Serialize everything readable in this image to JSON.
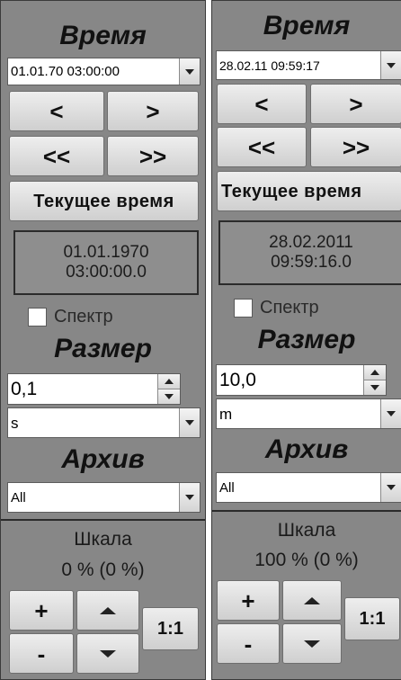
{
  "panel_a": {
    "time_title": "Время",
    "time_combo_value": "01.01.70 03:00:00",
    "prev_label": "<",
    "next_label": ">",
    "fast_prev_label": "<<",
    "fast_next_label": ">>",
    "current_time_label": "Текущее время",
    "display_date": "01.01.1970",
    "display_time": "03:00:00.0",
    "spectrum_label": "Спектр",
    "size_title": "Размер",
    "size_value": "0,1",
    "unit_value": "s",
    "archive_title": "Архив",
    "archive_value": "All",
    "scale_title": "Шкала",
    "scale_value": "0 % (0 %)",
    "plus_label": "+",
    "minus_label": "-",
    "ratio_label": "1:1"
  },
  "panel_b": {
    "time_title": "Время",
    "time_combo_value": "28.02.11 09:59:17",
    "prev_label": "<",
    "next_label": ">",
    "fast_prev_label": "<<",
    "fast_next_label": ">>",
    "current_time_label": "Текущее время",
    "display_date": "28.02.2011",
    "display_time": "09:59:16.0",
    "spectrum_label": "Спектр",
    "size_title": "Размер",
    "size_value": "10,0",
    "unit_value": "m",
    "archive_title": "Архив",
    "archive_value": "All",
    "scale_title": "Шкала",
    "scale_value": "100 % (0 %)",
    "plus_label": "+",
    "minus_label": "-",
    "ratio_label": "1:1"
  },
  "colors": {
    "panel_background": "#878787",
    "button_face": "#e4e4e4",
    "field_background": "#ffffff",
    "border_dark": "#2b2b2b"
  }
}
